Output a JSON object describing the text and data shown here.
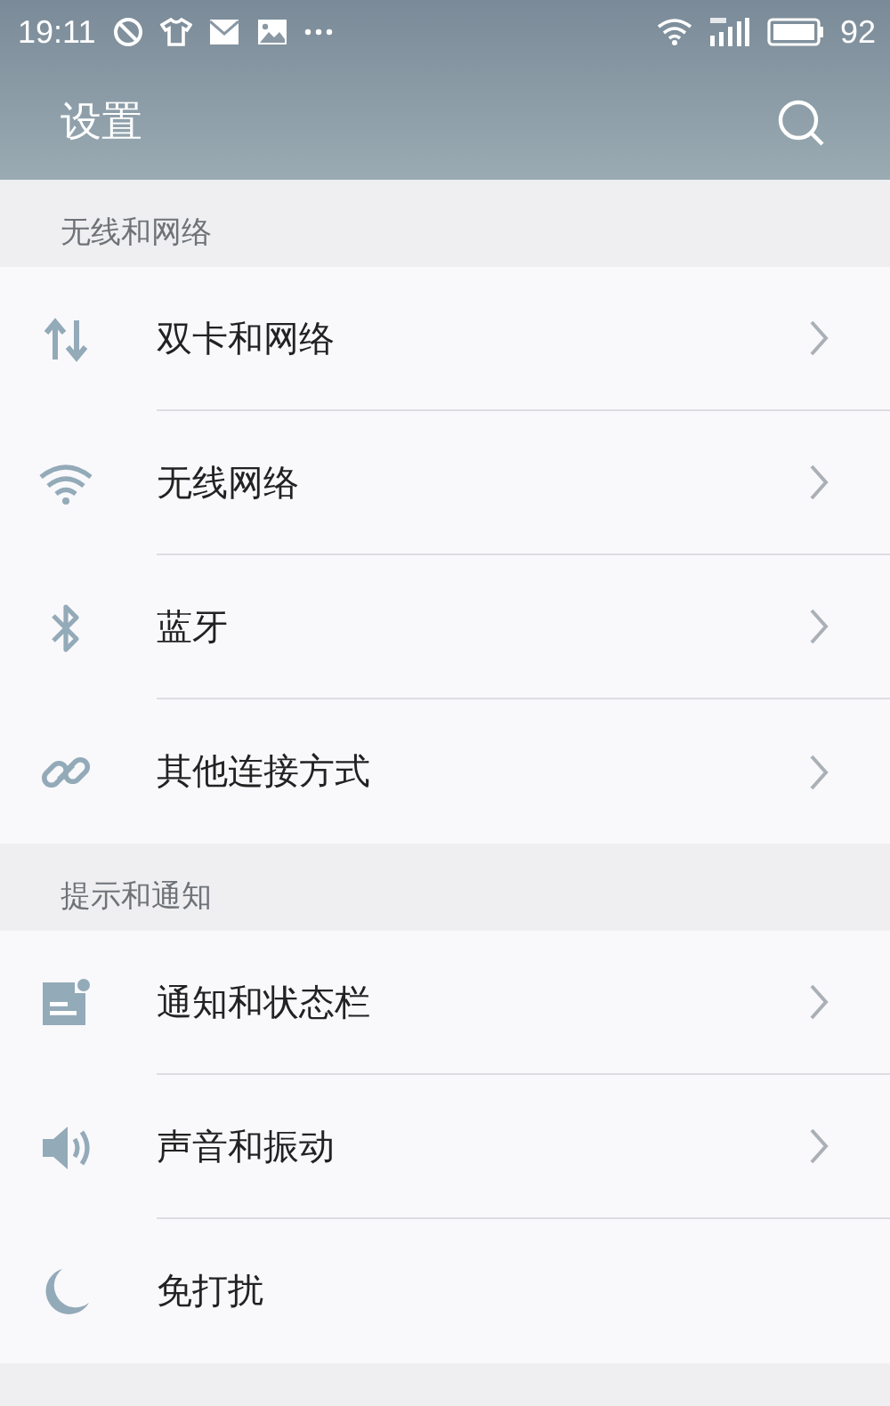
{
  "status_bar": {
    "time": "19:11",
    "battery": "92"
  },
  "app_bar": {
    "title": "设置"
  },
  "sections": [
    {
      "title": "无线和网络",
      "items": [
        {
          "label": "双卡和网络",
          "kind": "arrows",
          "chevron": true
        },
        {
          "label": "无线网络",
          "kind": "wifi",
          "chevron": true
        },
        {
          "label": "蓝牙",
          "kind": "bluetooth",
          "chevron": true
        },
        {
          "label": "其他连接方式",
          "kind": "link",
          "chevron": true
        }
      ]
    },
    {
      "title": "提示和通知",
      "items": [
        {
          "label": "通知和状态栏",
          "kind": "notification",
          "chevron": true
        },
        {
          "label": "声音和振动",
          "kind": "speaker",
          "chevron": true
        },
        {
          "label": "免打扰",
          "kind": "moon",
          "chevron": false
        }
      ]
    }
  ]
}
